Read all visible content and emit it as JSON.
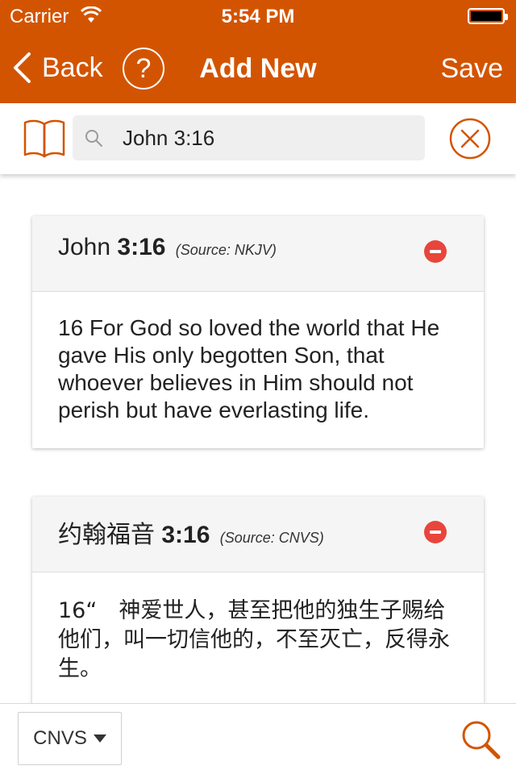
{
  "status_bar": {
    "carrier": "Carrier",
    "time": "5:54 PM"
  },
  "nav": {
    "back_label": "Back",
    "help_label": "?",
    "title": "Add New",
    "save_label": "Save"
  },
  "search": {
    "query": "John 3:16"
  },
  "verses": [
    {
      "book": "John",
      "chapter_verse": "3:16",
      "source": "(Source: NKJV)",
      "text": "16 For God so loved the world that He gave His only begotten Son, that whoever believes in Him should not perish but have everlasting life."
    },
    {
      "book": "约翰福音",
      "chapter_verse": "3:16",
      "source": "(Source: CNVS)",
      "text": "16“　神爱世人，甚至把他的独生子赐给他们，叫一切信他的，不至灭亡，反得永生。"
    }
  ],
  "toolbar": {
    "version_label": "CNVS"
  },
  "colors": {
    "accent": "#d35400",
    "remove": "#e8453c"
  }
}
